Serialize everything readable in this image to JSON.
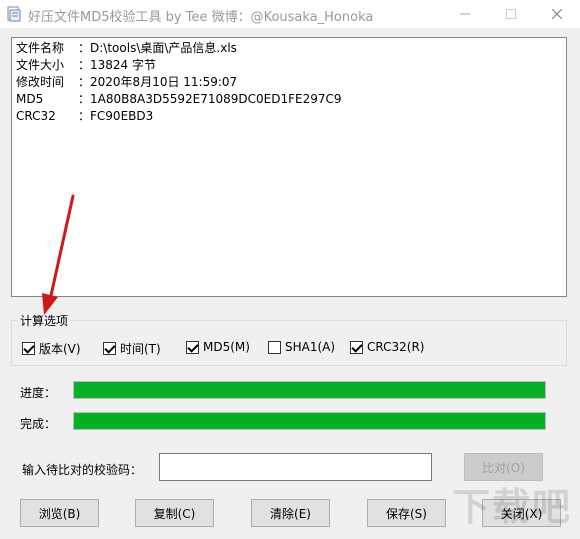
{
  "window": {
    "title": "好压文件MD5校验工具 by Tee    微博：@Kousaka_Honoka",
    "min_icon": "minimize-icon",
    "max_icon": "maximize-icon",
    "close_icon": "close-icon"
  },
  "file_info": [
    {
      "label": "文件名称",
      "sep": "：",
      "value": "D:\\tools\\桌面\\产品信息.xls"
    },
    {
      "label": "文件大小",
      "sep": "：",
      "value": "13824 字节"
    },
    {
      "label": "修改时间",
      "sep": "：",
      "value": "2020年8月10日 11:59:07"
    },
    {
      "label": "MD5",
      "sep": "：",
      "value": "1A80B8A3D5592E71089DC0ED1FE297C9"
    },
    {
      "label": "CRC32",
      "sep": "：",
      "value": "FC90EBD3"
    }
  ],
  "options": {
    "group_title": "计算选项",
    "items": [
      {
        "label": "版本(V)",
        "checked": true
      },
      {
        "label": "时间(T)",
        "checked": true
      },
      {
        "label": "MD5(M)",
        "checked": true
      },
      {
        "label": "SHA1(A)",
        "checked": false
      },
      {
        "label": "CRC32(R)",
        "checked": true
      }
    ]
  },
  "progress": {
    "label": "进度：",
    "value": 1.0
  },
  "complete": {
    "label": "完成：",
    "value": 1.0
  },
  "compare": {
    "label": "输入待比对的校验码：",
    "value": "",
    "button": "比对(O)"
  },
  "buttons": {
    "browse": "浏览(B)",
    "copy": "复制(C)",
    "clear": "清除(E)",
    "save": "保存(S)",
    "close": "关闭(X)"
  },
  "watermark": "下载吧",
  "colors": {
    "progress_fill": "#06b025",
    "arrow": "#d0171b"
  }
}
